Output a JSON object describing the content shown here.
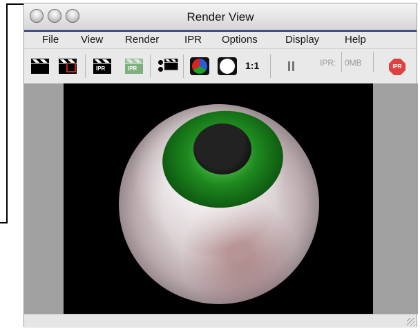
{
  "window": {
    "title": "Render View"
  },
  "menu": [
    "File",
    "View",
    "Render",
    "IPR",
    "Options",
    "Display",
    "Help"
  ],
  "toolbar": {
    "buttons": [
      {
        "icon": "render-clapper-icon"
      },
      {
        "icon": "render-region-icon"
      },
      {
        "icon": "ipr-render-icon",
        "text": "IPR"
      },
      {
        "icon": "ipr-refresh-icon",
        "text": "IPR"
      },
      {
        "icon": "snapshot-icon"
      },
      {
        "icon": "rgb-channels-icon"
      },
      {
        "icon": "alpha-channel-icon"
      },
      {
        "icon": "pause-icon"
      },
      {
        "icon": "stop-ipr-icon",
        "text": "IPR"
      }
    ],
    "ratio_label": "1:1",
    "ipr_label": "IPR:",
    "ipr_memory": "0MB"
  },
  "colors": {
    "menu_accent": "#1c2a8c",
    "iris": "#1f8a1f",
    "stop": "#e04040"
  }
}
